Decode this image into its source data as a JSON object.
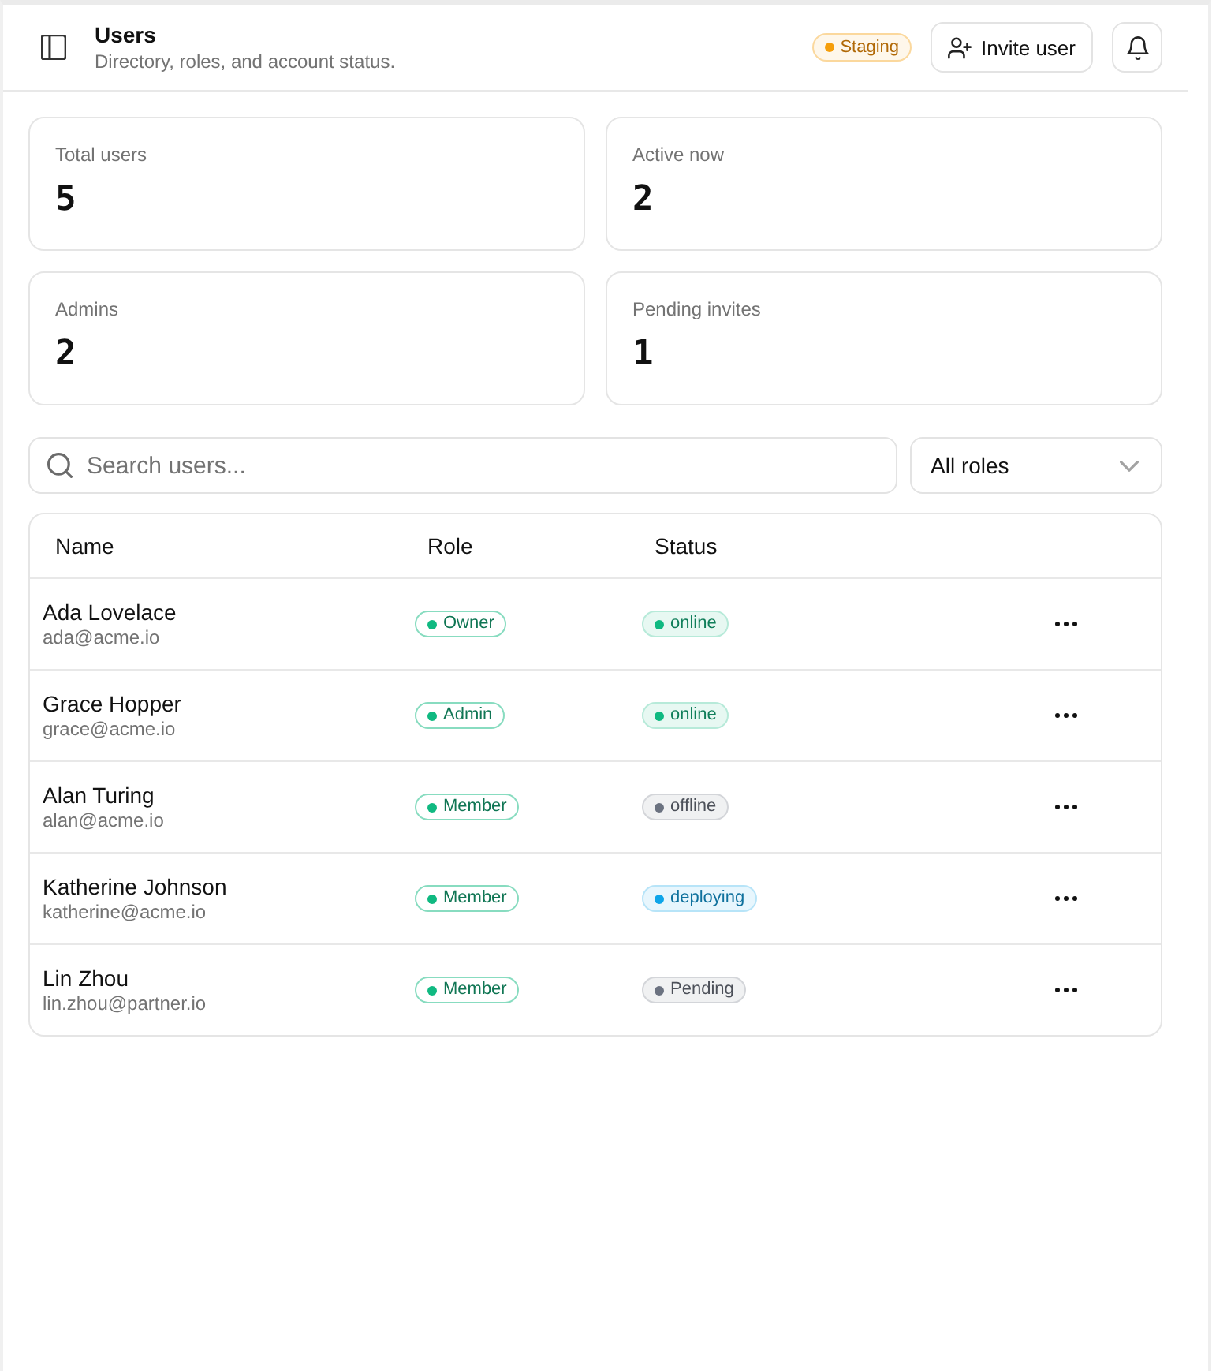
{
  "header": {
    "title": "Users",
    "subtitle": "Directory, roles, and account status.",
    "environment": {
      "label": "Staging",
      "color": "#f59e0b"
    },
    "invite_button": "Invite user"
  },
  "stats": [
    {
      "label": "Total users",
      "value": "5"
    },
    {
      "label": "Active now",
      "value": "2"
    },
    {
      "label": "Admins",
      "value": "2"
    },
    {
      "label": "Pending invites",
      "value": "1"
    }
  ],
  "filters": {
    "search": {
      "placeholder": "Search users..."
    },
    "role_filter": {
      "value": "All roles"
    }
  },
  "table": {
    "columns": [
      "Name",
      "Role",
      "Status"
    ],
    "rows": [
      {
        "name": "Ada Lovelace",
        "email": "ada@acme.io",
        "role": {
          "label": "Owner",
          "color": "#10b981"
        },
        "status": {
          "label": "online",
          "color": "#10b981"
        }
      },
      {
        "name": "Grace Hopper",
        "email": "grace@acme.io",
        "role": {
          "label": "Admin",
          "color": "#10b981"
        },
        "status": {
          "label": "online",
          "color": "#10b981"
        }
      },
      {
        "name": "Alan Turing",
        "email": "alan@acme.io",
        "role": {
          "label": "Member",
          "color": "#10b981"
        },
        "status": {
          "label": "offline",
          "color": "#6b7280"
        }
      },
      {
        "name": "Katherine Johnson",
        "email": "katherine@acme.io",
        "role": {
          "label": "Member",
          "color": "#10b981"
        },
        "status": {
          "label": "deploying",
          "color": "#0ea5e9"
        }
      },
      {
        "name": "Lin Zhou",
        "email": "lin.zhou@partner.io",
        "role": {
          "label": "Member",
          "color": "#10b981"
        },
        "status": {
          "label": "Pending",
          "color": "#6b7280"
        }
      }
    ]
  }
}
